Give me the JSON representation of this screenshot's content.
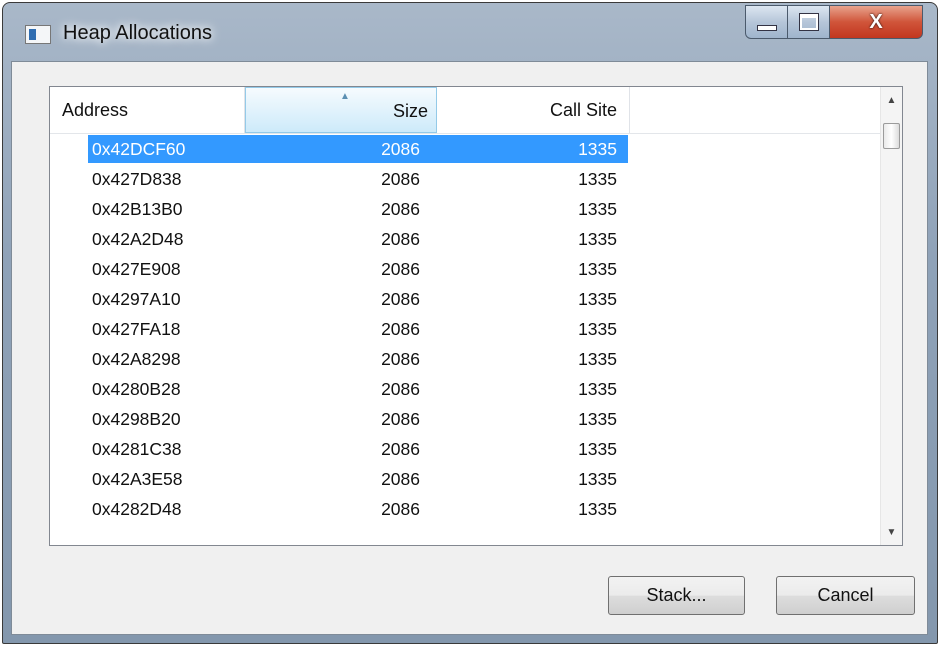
{
  "window": {
    "title": "Heap Allocations",
    "close_label": "X"
  },
  "table": {
    "columns": [
      "Address",
      "Size",
      "Call Site"
    ],
    "rows": [
      {
        "address": "0x42DCF60",
        "size": "2086",
        "call_site": "1335"
      },
      {
        "address": "0x427D838",
        "size": "2086",
        "call_site": "1335"
      },
      {
        "address": "0x42B13B0",
        "size": "2086",
        "call_site": "1335"
      },
      {
        "address": "0x42A2D48",
        "size": "2086",
        "call_site": "1335"
      },
      {
        "address": "0x427E908",
        "size": "2086",
        "call_site": "1335"
      },
      {
        "address": "0x4297A10",
        "size": "2086",
        "call_site": "1335"
      },
      {
        "address": "0x427FA18",
        "size": "2086",
        "call_site": "1335"
      },
      {
        "address": "0x42A8298",
        "size": "2086",
        "call_site": "1335"
      },
      {
        "address": "0x4280B28",
        "size": "2086",
        "call_site": "1335"
      },
      {
        "address": "0x4298B20",
        "size": "2086",
        "call_site": "1335"
      },
      {
        "address": "0x4281C38",
        "size": "2086",
        "call_site": "1335"
      },
      {
        "address": "0x42A3E58",
        "size": "2086",
        "call_site": "1335"
      },
      {
        "address": "0x4282D48",
        "size": "2086",
        "call_site": "1335"
      }
    ],
    "selected_row": 0,
    "sort_column": "Size"
  },
  "buttons": {
    "stack": "Stack...",
    "cancel": "Cancel"
  }
}
